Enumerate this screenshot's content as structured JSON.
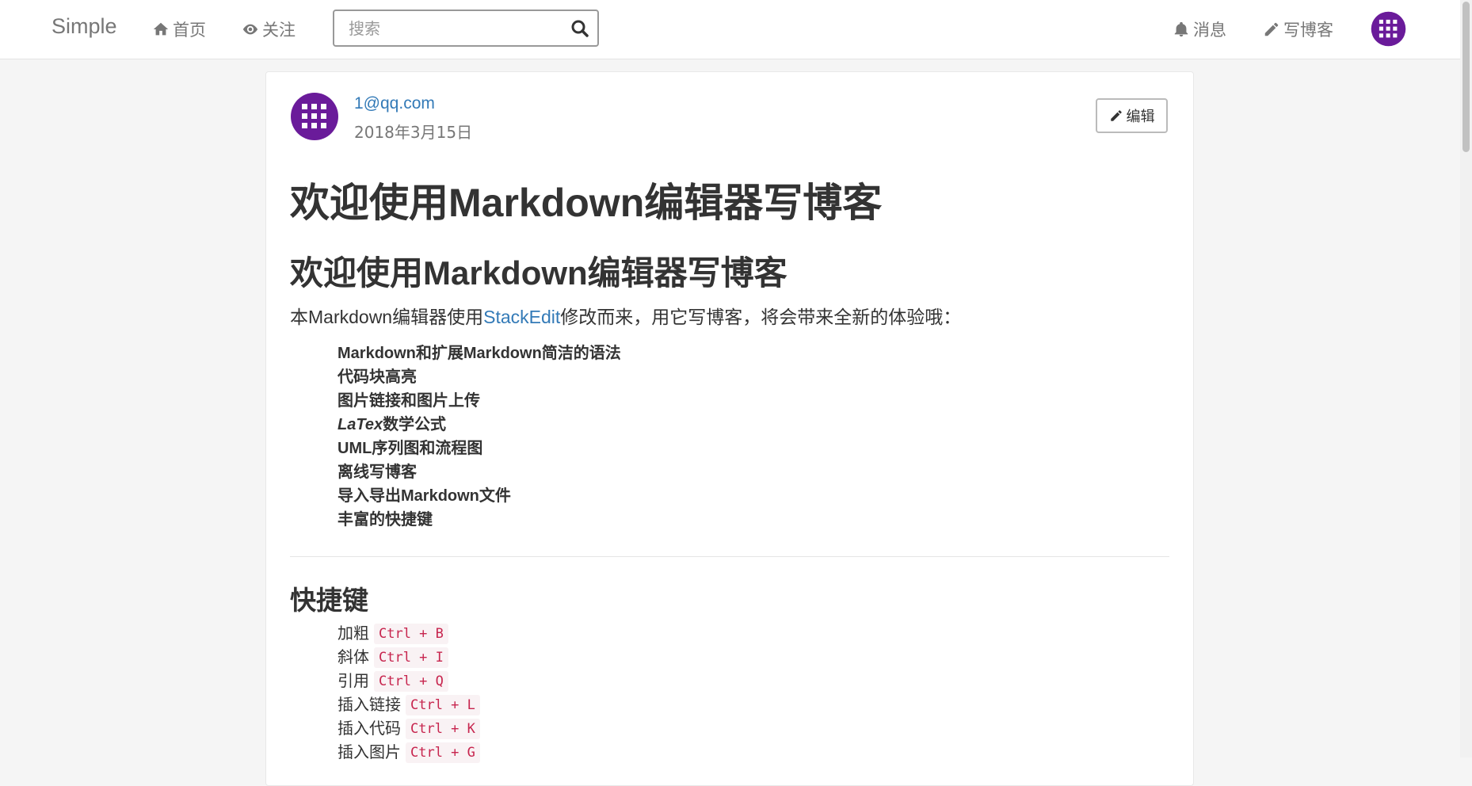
{
  "navbar": {
    "brand": "Simple",
    "home_label": "首页",
    "follow_label": "关注",
    "search_placeholder": "搜索",
    "messages_label": "消息",
    "write_label": "写博客"
  },
  "post": {
    "author": "1@qq.com",
    "date": "2018年3月15日",
    "edit_label": "编辑",
    "h1": "欢迎使用Markdown编辑器写博客",
    "h2": "欢迎使用Markdown编辑器写博客",
    "intro_before": "本Markdown编辑器使用",
    "intro_link": "StackEdit",
    "intro_after": "修改而来，用它写博客，将会带来全新的体验哦：",
    "features": [
      "Markdown和扩展Markdown简洁的语法",
      "代码块高亮",
      "图片链接和图片上传",
      "数学公式",
      "UML序列图和流程图",
      "离线写博客",
      "导入导出Markdown文件",
      "丰富的快捷键"
    ],
    "latex_prefix": "LaTex",
    "shortcuts_heading": "快捷键",
    "shortcuts": [
      {
        "label": "加粗",
        "keys": "Ctrl + B"
      },
      {
        "label": "斜体",
        "keys": "Ctrl + I"
      },
      {
        "label": "引用",
        "keys": "Ctrl + Q"
      },
      {
        "label": "插入链接",
        "keys": "Ctrl + L"
      },
      {
        "label": "插入代码",
        "keys": "Ctrl + K"
      },
      {
        "label": "插入图片",
        "keys": "Ctrl + G"
      }
    ]
  },
  "colors": {
    "avatar": "#6a1b9a",
    "link": "#337ab7",
    "code": "#c7254e"
  },
  "icons": {
    "home": "home-icon",
    "follow": "eye-icon",
    "search": "search-icon",
    "messages": "bell-icon",
    "write": "pencil-icon",
    "edit": "pencil-icon"
  }
}
